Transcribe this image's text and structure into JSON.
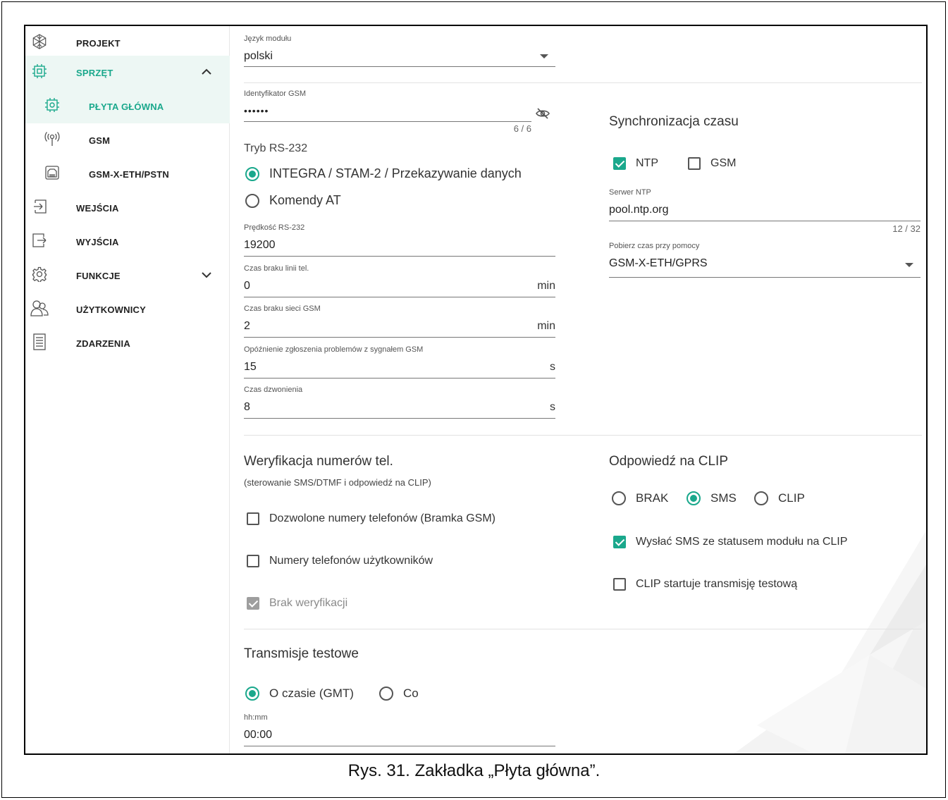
{
  "caption": "Rys. 31. Zakładka „Płyta główna”.",
  "sidebar": {
    "items": [
      {
        "label": "PROJEKT",
        "icon": "snowflake-icon"
      },
      {
        "label": "SPRZĘT",
        "icon": "chip-icon"
      },
      {
        "label": "PŁYTA GŁÓWNA",
        "icon": "gear-chip-icon"
      },
      {
        "label": "GSM",
        "icon": "antenna-icon"
      },
      {
        "label": "GSM-X-ETH/PSTN",
        "icon": "ethernet-icon"
      },
      {
        "label": "WEJŚCIA",
        "icon": "input-icon"
      },
      {
        "label": "WYJŚCIA",
        "icon": "output-icon"
      },
      {
        "label": "FUNKCJE",
        "icon": "gear-icon"
      },
      {
        "label": "UŻYTKOWNICY",
        "icon": "users-icon"
      },
      {
        "label": "ZDARZENIA",
        "icon": "document-icon"
      }
    ]
  },
  "module_language": {
    "label": "Język modułu",
    "value": "polski"
  },
  "gsm_id": {
    "label": "Identyfikator GSM",
    "value": "••••••",
    "counter": "6 / 6"
  },
  "rs232_mode": {
    "label": "Tryb RS-232",
    "options": [
      "INTEGRA / STAM-2 / Przekazywanie danych",
      "Komendy AT"
    ],
    "selected": 0
  },
  "rs232_speed": {
    "label": "Prędkość RS-232",
    "value": "19200"
  },
  "phone_line_loss": {
    "label": "Czas braku linii tel.",
    "value": "0",
    "unit": "min"
  },
  "gsm_loss": {
    "label": "Czas braku sieci GSM",
    "value": "2",
    "unit": "min"
  },
  "gsm_signal_delay": {
    "label": "Opóźnienie zgłoszenia problemów z sygnałem GSM",
    "value": "15",
    "unit": "s"
  },
  "ring_time": {
    "label": "Czas dzwonienia",
    "value": "8",
    "unit": "s"
  },
  "time_sync": {
    "title": "Synchronizacja czasu",
    "ntp_label": "NTP",
    "ntp_checked": true,
    "gsm_label": "GSM",
    "gsm_checked": false,
    "server_label": "Serwer NTP",
    "server_value": "pool.ntp.org",
    "server_counter": "12 / 32",
    "source_label": "Pobierz czas przy pomocy",
    "source_value": "GSM-X-ETH/GPRS"
  },
  "verification": {
    "title": "Weryfikacja numerów tel.",
    "subtitle": "(sterowanie SMS/DTMF i odpowiedź na CLIP)",
    "options": [
      {
        "label": "Dozwolone numery telefonów (Bramka GSM)",
        "checked": false
      },
      {
        "label": "Numery telefonów użytkowników",
        "checked": false
      },
      {
        "label": "Brak weryfikacji",
        "checked": true,
        "disabled": true
      }
    ]
  },
  "clip": {
    "title": "Odpowiedź na CLIP",
    "options": [
      "BRAK",
      "SMS",
      "CLIP"
    ],
    "selected": 1,
    "send_sms_label": "Wysłać SMS ze statusem modułu na CLIP",
    "send_sms_checked": true,
    "clip_test_label": "CLIP startuje transmisję testową",
    "clip_test_checked": false
  },
  "test_transmissions": {
    "title": "Transmisje testowe",
    "options": [
      "O czasie (GMT)",
      "Co"
    ],
    "selected": 0,
    "time_label": "hh:mm",
    "time_value": "00:00"
  },
  "colors": {
    "accent": "#1aa88c",
    "active_bg": "#edf7f4"
  }
}
